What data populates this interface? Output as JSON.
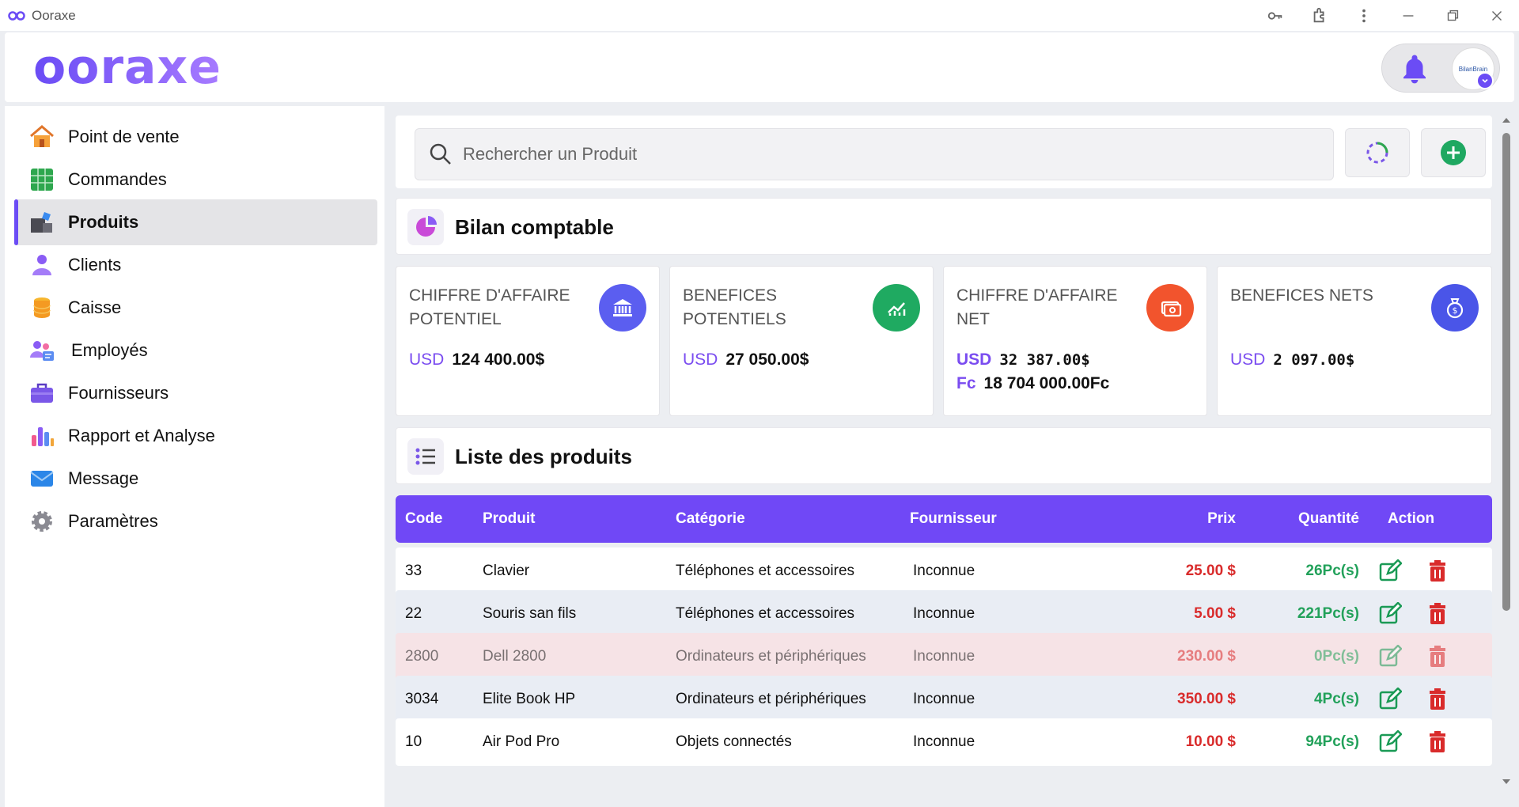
{
  "window": {
    "title": "Ooraxe"
  },
  "header": {
    "brand": "ooraxe",
    "avatar_text": "BilanBrain"
  },
  "sidebar": {
    "items": [
      {
        "label": "Point de vente",
        "icon": "home-icon"
      },
      {
        "label": "Commandes",
        "icon": "grid-icon"
      },
      {
        "label": "Produits",
        "icon": "products-icon",
        "active": true
      },
      {
        "label": "Clients",
        "icon": "user-icon"
      },
      {
        "label": "Caisse",
        "icon": "coins-icon"
      },
      {
        "label": "Employés",
        "icon": "employees-icon"
      },
      {
        "label": "Fournisseurs",
        "icon": "briefcase-icon"
      },
      {
        "label": "Rapport et Analyse",
        "icon": "bar-chart-icon"
      },
      {
        "label": "Message",
        "icon": "mail-icon"
      },
      {
        "label": "Paramètres",
        "icon": "gear-icon"
      }
    ]
  },
  "search": {
    "placeholder": "Rechercher un Produit"
  },
  "bilan": {
    "title": "Bilan comptable",
    "cards": [
      {
        "title": "CHIFFRE D'AFFAIRE POTENTIEL",
        "lines": [
          {
            "currency": "USD",
            "amount": "124 400.00$"
          }
        ],
        "icon_color": "#5b5ef0"
      },
      {
        "title": "BENEFICES POTENTIELS",
        "lines": [
          {
            "currency": "USD",
            "amount": "27 050.00$"
          }
        ],
        "icon_color": "#1faa61"
      },
      {
        "title": "CHIFFRE D'AFFAIRE NET",
        "lines": [
          {
            "currency": "USD",
            "amount": "32 387.00$"
          },
          {
            "currency": "Fc",
            "amount": "18 704 000.00Fc"
          }
        ],
        "icon_color": "#f2542d"
      },
      {
        "title": "BENEFICES NETS",
        "lines": [
          {
            "currency": "USD",
            "amount": "2 097.00$"
          }
        ],
        "icon_color": "#4a55e8"
      }
    ]
  },
  "products": {
    "title": "Liste des produits",
    "columns": {
      "code": "Code",
      "product": "Produit",
      "category": "Catégorie",
      "supplier": "Fournisseur",
      "price": "Prix",
      "quantity": "Quantité",
      "action": "Action"
    },
    "rows": [
      {
        "code": "33",
        "product": "Clavier",
        "category": "Téléphones et accessoires",
        "supplier": "Inconnue",
        "price": "25.00 $",
        "quantity": "26Pc(s)"
      },
      {
        "code": "22",
        "product": "Souris san fils",
        "category": "Téléphones et accessoires",
        "supplier": "Inconnue",
        "price": "5.00 $",
        "quantity": "221Pc(s)"
      },
      {
        "code": "2800",
        "product": "Dell 2800",
        "category": "Ordinateurs et périphériques",
        "supplier": "Inconnue",
        "price": "230.00 $",
        "quantity": "0Pc(s)"
      },
      {
        "code": "3034",
        "product": "Elite Book HP",
        "category": "Ordinateurs et périphériques",
        "supplier": "Inconnue",
        "price": "350.00 $",
        "quantity": "4Pc(s)"
      },
      {
        "code": "10",
        "product": "Air Pod Pro",
        "category": "Objets connectés",
        "supplier": "Inconnue",
        "price": "10.00 $",
        "quantity": "94Pc(s)"
      }
    ]
  }
}
